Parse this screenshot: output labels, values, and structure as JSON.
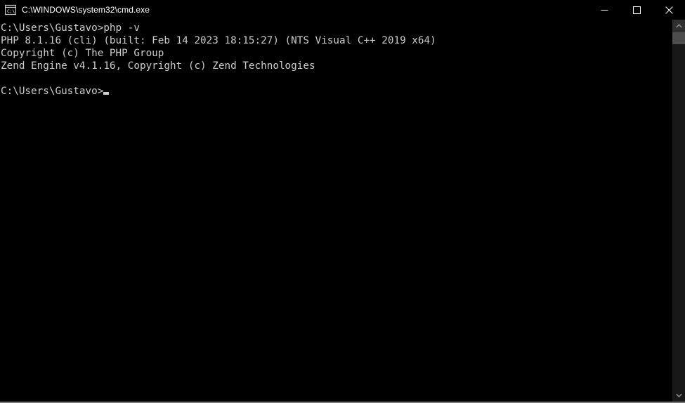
{
  "window": {
    "title": "C:\\WINDOWS\\system32\\cmd.exe",
    "icon_name": "cmd-console-icon",
    "icon_label": "C:\\",
    "background_color": "#000000",
    "text_color": "#cccccc"
  },
  "window_controls": {
    "minimize_label": "Minimize",
    "maximize_label": "Maximize",
    "close_label": "Close"
  },
  "console": {
    "lines": [
      "C:\\Users\\Gustavo>php -v",
      "PHP 8.1.16 (cli) (built: Feb 14 2023 18:15:27) (NTS Visual C++ 2019 x64)",
      "Copyright (c) The PHP Group",
      "Zend Engine v4.1.16, Copyright (c) Zend Technologies",
      ""
    ],
    "current_prompt": "C:\\Users\\Gustavo>",
    "cursor_visible": true
  },
  "scrollbar": {
    "up_arrow_label": "Scroll up",
    "down_arrow_label": "Scroll down",
    "thumb_position_percent": 0,
    "track_color": "#181818",
    "thumb_color": "#4d4d4d",
    "button_color": "#303030"
  }
}
